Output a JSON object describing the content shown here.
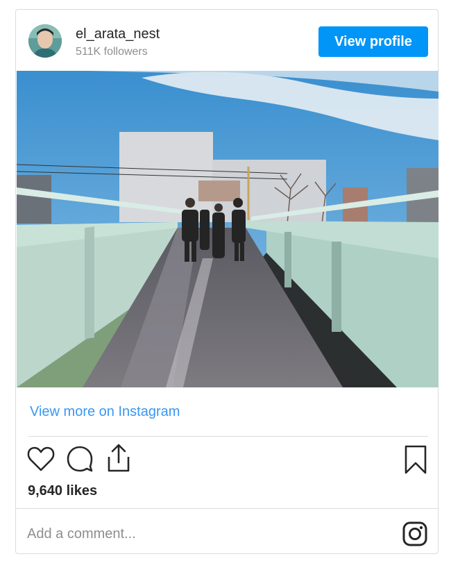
{
  "profile": {
    "username": "el_arata_nest",
    "followers": "511K followers",
    "view_profile_label": "View profile"
  },
  "post": {
    "view_more_label": "View more on Instagram",
    "likes": "9,640 likes"
  },
  "comment": {
    "placeholder": "Add a comment..."
  },
  "icons": [
    "heart-icon",
    "comment-icon",
    "share-icon",
    "bookmark-icon",
    "instagram-logo-icon"
  ],
  "colors": {
    "accent": "#0095f6",
    "link": "#3897f0",
    "muted": "#8e8e8e",
    "border": "#dbdbdb"
  }
}
